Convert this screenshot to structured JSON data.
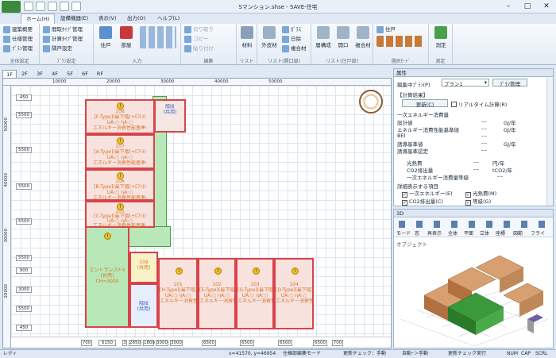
{
  "app": {
    "title": "Sマンション.shse - SAVE-住宅"
  },
  "ribbon_tabs": [
    {
      "label": "ホーム(H)"
    },
    {
      "label": "設備機器(E)"
    },
    {
      "label": "表示(V)"
    },
    {
      "label": "出力(O)"
    },
    {
      "label": "ヘルプ(L)"
    }
  ],
  "ribbon": {
    "overall": {
      "label": "全体設定",
      "items": [
        "建築概要",
        "仕様管理",
        "ﾌﾟﾗﾝ管理"
      ]
    },
    "plan": {
      "label": "ﾌﾟﾗﾝ設定",
      "items": [
        "間取ﾀｲﾌﾟ管理",
        "計算ﾀｲﾌﾟ管理",
        "隣戸設定"
      ]
    },
    "input": {
      "label": "入力",
      "big": [
        "住戸",
        "部屋"
      ]
    },
    "edit": {
      "label": "編集",
      "items": [
        "切り取り",
        "コピー",
        "貼り付け"
      ]
    },
    "list": {
      "label": "リスト",
      "big": [
        "材料"
      ]
    },
    "list_opening": {
      "label": "リスト(開口部)",
      "items": [
        "外皮材",
        "ｶﾞﾗｽ",
        "日除",
        "複合材"
      ]
    },
    "list_house": {
      "label": "リスト(住戸部)",
      "big": [
        "層構成",
        "開口",
        "複合材"
      ]
    },
    "select_mode": {
      "label": "選択ﾓｰﾄﾞ",
      "items": [
        "住戸"
      ]
    },
    "measure": {
      "label": "測定",
      "big": [
        "測定"
      ]
    }
  },
  "floor_tabs": [
    "1F",
    "2F",
    "3F",
    "4F",
    "5F",
    "6F",
    "RF"
  ],
  "drawing": {
    "top_ruler": [
      "10000",
      "20000",
      "30000",
      "40000",
      "50000"
    ],
    "left_ruler": [
      "50000",
      "40000",
      "30000",
      "20000"
    ],
    "left_dims": [
      "450",
      "5500",
      "5500",
      "5500",
      "5500",
      "5500",
      "900",
      "3000",
      "5500",
      "450"
    ],
    "units_vertical": [
      {
        "no": "108",
        "type": "[F-Type](最下階(+ﾛﾌﾄ))",
        "ua": "UA:○ ηA:○",
        "energy": "エネルギー消費性能基準:"
      },
      {
        "no": "107",
        "type": "[A-Type](最下階(+ﾛﾌﾄ))",
        "ua": "UA:○ ηA:○",
        "energy": "エネルギー消費性能基準:"
      },
      {
        "no": "106",
        "type": "[B-Type](最下階(+ﾛﾌﾄ))",
        "ua": "UA:○ ηA:○",
        "energy": "エネルギー消費性能基準:"
      },
      {
        "no": "105",
        "type": "[C-Type](最下階(+ﾛﾌﾄ))",
        "ua": "UA:○ ηA:○",
        "energy": "エネルギー消費性能基準:"
      }
    ],
    "units_horizontal": [
      {
        "no": "101",
        "type": "[H-Type](最下階)",
        "ua": "UA:○ ηA:○",
        "energy": "エネルギー消費性能基準:"
      },
      {
        "no": "102",
        "type": "[E-Type](最下階)",
        "ua": "UA:○ ηA:○",
        "energy": "エネルギー消費性能基準:"
      },
      {
        "no": "103",
        "type": "[G-Type](最下階)",
        "ua": "UA:○ ηA:○",
        "energy": "エネルギー消費性能基準:"
      },
      {
        "no": "104",
        "type": "[D-Type](最下階)",
        "ua": "UA:○ ηA:○",
        "energy": "エネルギー消費性能基準:"
      }
    ],
    "entrance": {
      "name": "エントランスﾎｰﾙ",
      "sub": "(共用)",
      "ch": "CH=3000"
    },
    "room_109": {
      "no": "109",
      "label": "(共用)"
    },
    "room_stair": {
      "label": "階段",
      "sub": "(共用)"
    },
    "bottom_dims": [
      "700",
      "6150",
      "3",
      "2850",
      "1800",
      "3000",
      "3000",
      "6500",
      "6500",
      "6500",
      "6500",
      "700"
    ]
  },
  "properties": {
    "header": "属性",
    "plan_label": "編集中ﾌﾟﾗﾝ(P)",
    "plan_value": "プラン1",
    "plan_manage": "ﾌﾟﾗﾝ管理",
    "calc_title": "【計算結果】",
    "update_btn": "更新(C)",
    "realtime": "リアルタイム計算(R)",
    "section_energy": "一次エネルギー消費量",
    "rows": [
      {
        "label": "設計値",
        "value": "---",
        "unit": "GJ/年"
      },
      {
        "label": "エネルギー消費性能基準値",
        "value": "---",
        "unit": "GJ/年"
      },
      {
        "label": "BEI",
        "value": "---",
        "unit": ""
      },
      {
        "label": "誘導基準値",
        "value": "---",
        "unit": "GJ/年"
      },
      {
        "label": "誘導基準認定",
        "value": "---",
        "unit": ""
      }
    ],
    "rows2": [
      {
        "label": "光熱費",
        "value": "---",
        "unit": "円/年"
      },
      {
        "label": "CO2排出量",
        "value": "---",
        "unit": "tCO2/年"
      },
      {
        "label": "一次エネルギー消費量等級",
        "value": "---",
        "unit": ""
      }
    ],
    "detail_title": "詳細表示する項目",
    "checks": [
      {
        "label": "一次エネルギー(E)",
        "checked": true
      },
      {
        "label": "光熱費(M)",
        "checked": true
      },
      {
        "label": "CO2排出量(C)",
        "checked": true
      },
      {
        "label": "等級(G)",
        "checked": true
      }
    ]
  },
  "view3d": {
    "header": "3D",
    "toolbar": [
      "モード",
      "窓",
      "再表示",
      "全体",
      "平面",
      "立体",
      "座標",
      "図範",
      "フライ"
    ],
    "object_label": "オブジェクト"
  },
  "status": {
    "ready": "レディ",
    "coords": "x=41570, y=46954",
    "mode": "住棟部編集モード",
    "check_manual": "更新チェック：手動",
    "auto": "自動ｰ＞手動",
    "run": "更新チェック実行",
    "num": "NUM",
    "cap": "CAP",
    "scr": "SCRL"
  },
  "colors": {
    "unit_border": "#d9434b",
    "unit_fill": "#f7e2de",
    "label": "#d8762a",
    "common": "#b8e8b8"
  }
}
